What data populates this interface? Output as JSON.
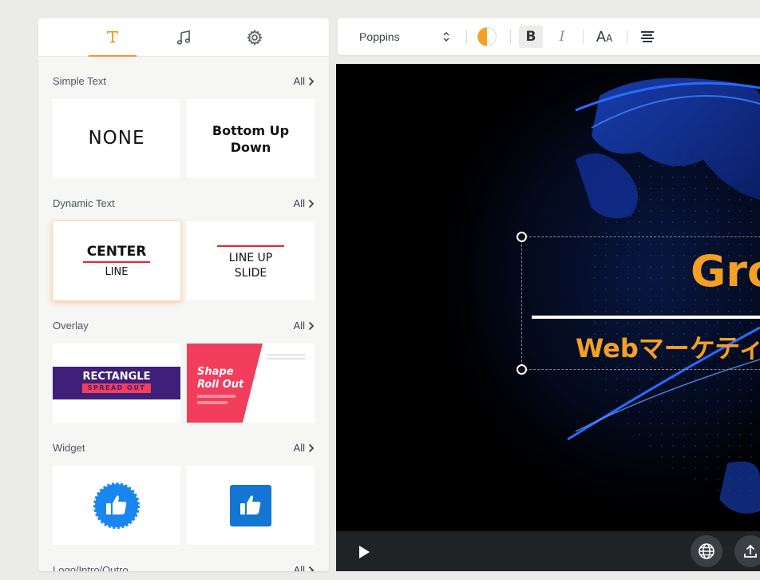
{
  "panel": {
    "tabs": [
      {
        "name": "text",
        "icon": "text-icon",
        "active": true
      },
      {
        "name": "music",
        "icon": "music-note-icon",
        "active": false
      },
      {
        "name": "settings",
        "icon": "gear-icon",
        "active": false
      }
    ],
    "all_label": "All",
    "sections": [
      {
        "title": "Simple Text",
        "cards": [
          {
            "text": "NONE"
          },
          {
            "line1": "Bottom Up",
            "line2": "Down"
          }
        ]
      },
      {
        "title": "Dynamic Text",
        "cards": [
          {
            "line1": "CENTER",
            "line2": "LINE"
          },
          {
            "line1": "LINE UP",
            "line2": "SLIDE"
          }
        ]
      },
      {
        "title": "Overlay",
        "cards": [
          {
            "line1": "RECTANGLE",
            "line2": "SPREAD OUT"
          },
          {
            "line1": "Shape",
            "line2": "Roll Out"
          }
        ]
      },
      {
        "title": "Widget",
        "cards": [
          {
            "icon": "thumbs-up-badge-icon"
          },
          {
            "icon": "thumbs-up-square-icon"
          }
        ]
      },
      {
        "title": "Logo/Intro/Outro"
      }
    ]
  },
  "toolbar": {
    "font": "Poppins",
    "bold": "B",
    "italic": "I",
    "size_big": "A",
    "size_small": "A"
  },
  "stage": {
    "title": "Gro",
    "subtitle": "Webマーケティ"
  },
  "colors": {
    "accent": "#f39a2e",
    "text_orange": "#f5a024",
    "overlay_purple": "#3e1f7a",
    "overlay_pink": "#f23d5d",
    "widget_blue": "#1a86f0",
    "widget_blue_dark": "#1476d2"
  }
}
